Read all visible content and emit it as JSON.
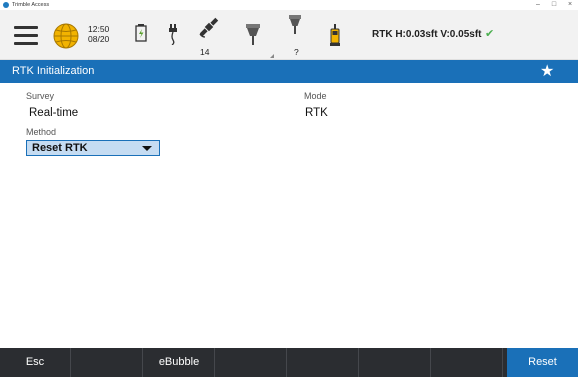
{
  "window": {
    "title": "Trimble Access",
    "minimize": "–",
    "restore": "□",
    "close": "×"
  },
  "statusbar": {
    "time": "12:50",
    "date": "08/20",
    "satellites": "14",
    "receiver_unknown": "?",
    "rtk_status": "RTK H:0.03sft V:0.05sft",
    "check_color": "#4caf50",
    "icons": [
      "menu-icon",
      "globe-icon",
      "battery-icon",
      "cable-icon",
      "satellite-icon",
      "gnss-receiver-icon",
      "gnss-receiver-question-icon",
      "controller-icon",
      "check-icon"
    ]
  },
  "header": {
    "title": "RTK Initialization",
    "star_icon": "star-icon",
    "color": "#1a70b8"
  },
  "form": {
    "survey_label": "Survey",
    "survey_value": "Real-time",
    "mode_label": "Mode",
    "mode_value": "RTK",
    "method_label": "Method",
    "method_selected": "Reset RTK"
  },
  "softkeys": {
    "esc": "Esc",
    "ebubble": "eBubble",
    "reset": "Reset"
  }
}
